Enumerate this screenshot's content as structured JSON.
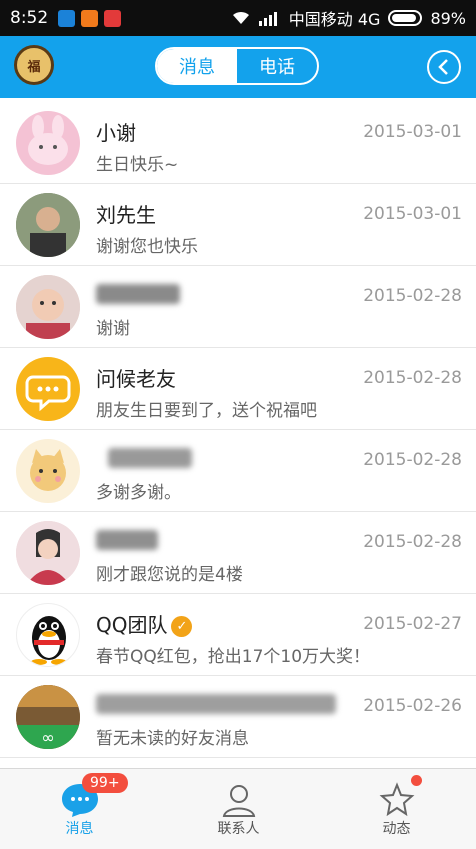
{
  "status_bar": {
    "time": "8:52",
    "carrier": "中国移动 4G",
    "battery": "89%"
  },
  "header": {
    "logo_text": "福",
    "tabs": [
      {
        "label": "消息",
        "active": true
      },
      {
        "label": "电话",
        "active": false
      }
    ]
  },
  "conversations": [
    {
      "name": "小谢",
      "date": "2015-03-01",
      "message": "生日快乐~",
      "avatar": "bunny",
      "name_visible": true
    },
    {
      "name": "刘先生",
      "date": "2015-03-01",
      "message": "谢谢您也快乐",
      "avatar": "man",
      "name_visible": true
    },
    {
      "name": "",
      "date": "2015-02-28",
      "message": "谢谢",
      "avatar": "baby",
      "name_visible": false
    },
    {
      "name": "问候老友",
      "date": "2015-02-28",
      "message": "朋友生日要到了，送个祝福吧",
      "avatar": "chat-bubble",
      "name_visible": true
    },
    {
      "name": "",
      "date": "2015-02-28",
      "message": "多谢多谢。",
      "avatar": "cat",
      "name_visible": false
    },
    {
      "name": "",
      "date": "2015-02-28",
      "message": "刚才跟您说的是4楼",
      "avatar": "woman",
      "name_visible": false
    },
    {
      "name": "QQ团队",
      "date": "2015-02-27",
      "message": "春节QQ红包，抢出17个10万大奖！",
      "avatar": "penguin",
      "name_visible": true,
      "verified": true
    },
    {
      "name": "",
      "date": "2015-02-26",
      "message": "暂无未读的好友消息",
      "avatar": "shop",
      "name_visible": false
    }
  ],
  "tabbar": {
    "items": [
      {
        "label": "消息",
        "active": true
      },
      {
        "label": "联系人",
        "active": false
      },
      {
        "label": "动态",
        "active": false
      }
    ],
    "unread_badge": "99+"
  },
  "colors": {
    "accent": "#13a2ec",
    "date": "#9a9a9a",
    "badge": "#f34e3e"
  }
}
